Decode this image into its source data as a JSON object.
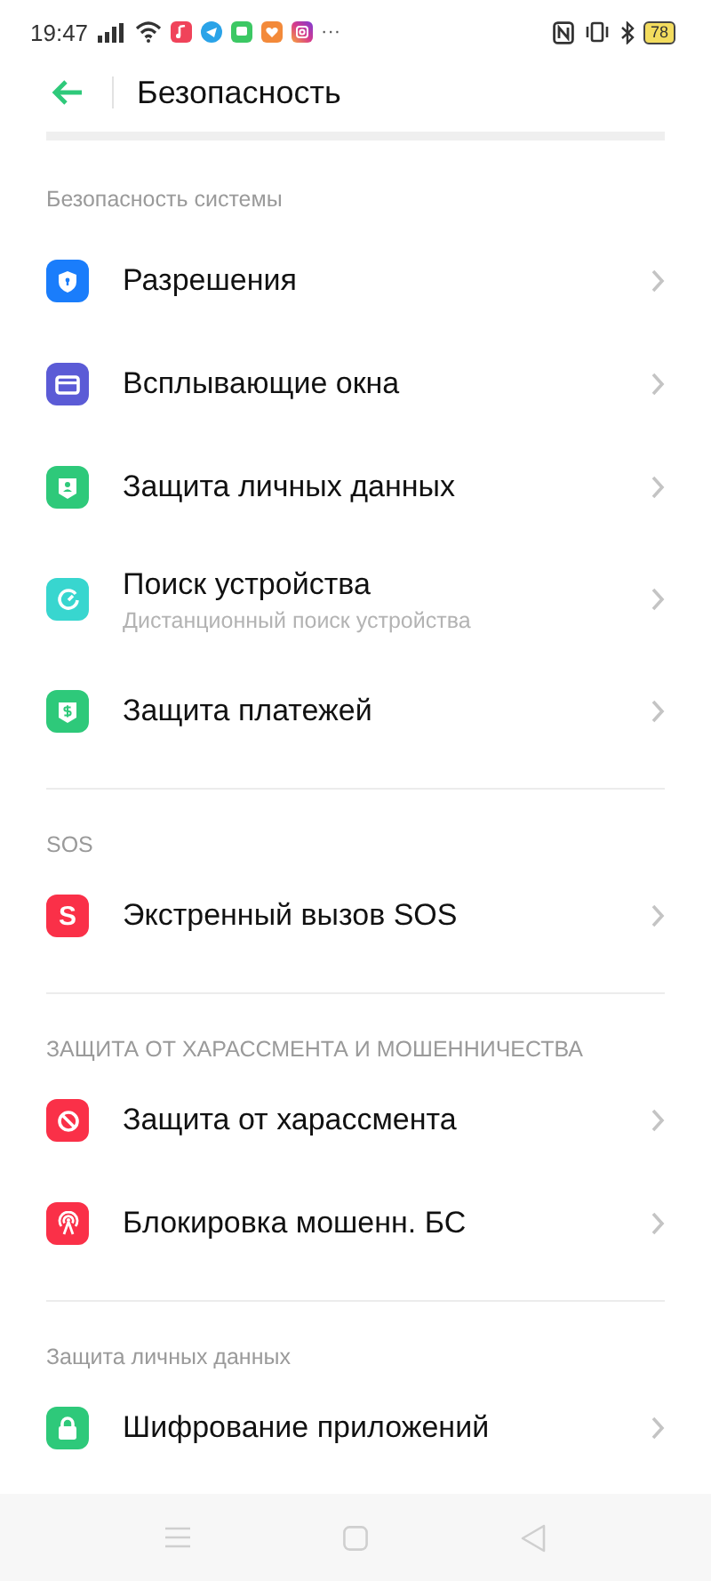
{
  "status_bar": {
    "time": "19:47",
    "more": "···",
    "battery": "78"
  },
  "header": {
    "title": "Безопасность"
  },
  "sections": [
    {
      "title": "Безопасность системы",
      "items": [
        {
          "label": "Разрешения",
          "kind": "shield",
          "color": "#1a7dfb"
        },
        {
          "label": "Всплывающие окна",
          "kind": "window",
          "color": "#5b5bd6"
        },
        {
          "label": "Защита личных данных",
          "kind": "person",
          "color": "#2ec97a"
        },
        {
          "label": "Поиск устройства",
          "subtitle": "Дистанционный поиск устройства",
          "kind": "gauge",
          "color": "#38d6cf"
        },
        {
          "label": "Защита платежей",
          "kind": "dollar",
          "color": "#2ec97a"
        }
      ]
    },
    {
      "title": "SOS",
      "items": [
        {
          "label": "Экстренный вызов SOS",
          "kind": "letter",
          "badge": "S",
          "color": "#fa3048"
        }
      ]
    },
    {
      "title": "ЗАЩИТА ОТ ХАРАССМЕНТА И МОШЕННИЧЕСТВА",
      "items": [
        {
          "label": "Защита от харассмента",
          "kind": "block",
          "color": "#fa3048"
        },
        {
          "label": "Блокировка мошенн. БС",
          "kind": "tower",
          "color": "#fa3048"
        }
      ]
    },
    {
      "title": "Защита личных данных",
      "items": [
        {
          "label": "Шифрование приложений",
          "kind": "lock",
          "color": "#2ec97a"
        }
      ]
    }
  ]
}
